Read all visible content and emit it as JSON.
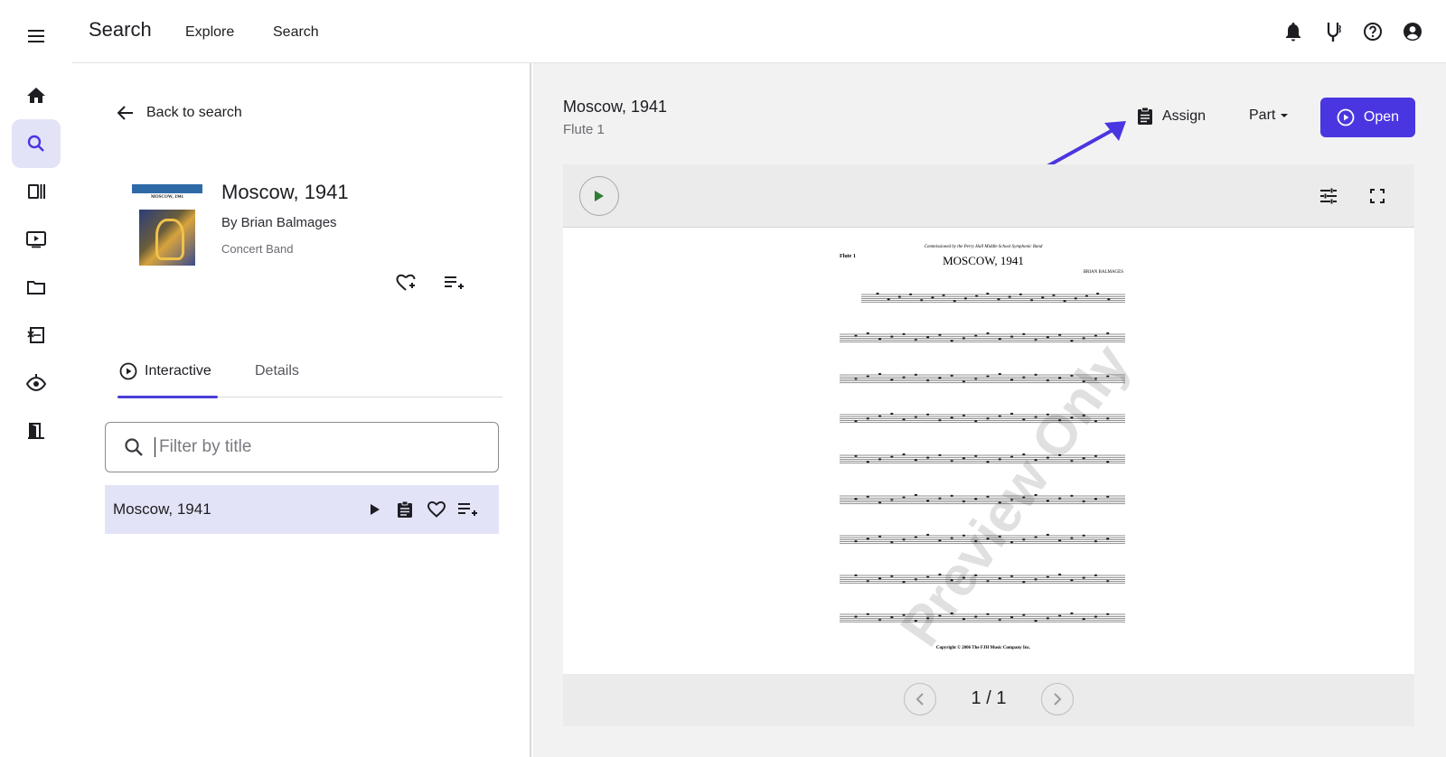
{
  "app": {
    "title": "Search",
    "nav": [
      {
        "label": "Explore"
      },
      {
        "label": "Search"
      }
    ],
    "accent": "#4a36e0",
    "highlight": "#e3e3f8"
  },
  "rail": {
    "items": [
      {
        "icon": "home-icon"
      },
      {
        "icon": "search-icon",
        "active": true
      },
      {
        "icon": "library-icon"
      },
      {
        "icon": "video-icon"
      },
      {
        "icon": "folder-icon"
      },
      {
        "icon": "assignment-icon"
      },
      {
        "icon": "listen-icon"
      },
      {
        "icon": "exit-icon"
      }
    ]
  },
  "topbar": {
    "icons": [
      "bell-icon",
      "tuning-fork-icon",
      "help-icon",
      "account-icon"
    ]
  },
  "left": {
    "back_label": "Back to search",
    "work": {
      "title": "Moscow, 1941",
      "composer": "By Brian Balmages",
      "genre": "Concert Band"
    },
    "tabs": [
      {
        "label": "Interactive",
        "active": true
      },
      {
        "label": "Details",
        "active": false
      }
    ],
    "filter_placeholder": "Filter by title",
    "results": [
      {
        "title": "Moscow, 1941"
      }
    ]
  },
  "right": {
    "title": "Moscow, 1941",
    "part": "Flute 1",
    "assign_label": "Assign",
    "part_label": "Part",
    "open_label": "Open",
    "pager": "1 / 1",
    "watermark": "Preview Only"
  },
  "sheet": {
    "part_name": "Flute 1",
    "title": "MOSCOW, 1941",
    "commission": "Commissioned by the Perry Hall Middle School Symphonic Band",
    "composer": "BRIAN BALMAGES",
    "copyright": "Copyright © 2006 The FJH Music Company Inc."
  }
}
